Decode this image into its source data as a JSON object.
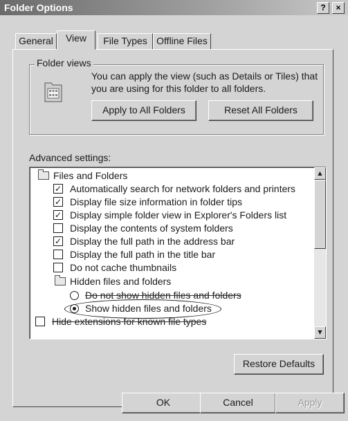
{
  "window": {
    "title": "Folder Options",
    "help_label": "?",
    "close_label": "×"
  },
  "tabs": [
    {
      "label": "General"
    },
    {
      "label": "View",
      "active": true
    },
    {
      "label": "File Types"
    },
    {
      "label": "Offline Files"
    }
  ],
  "folder_views": {
    "title": "Folder views",
    "description_line1": "You can apply the view (such as Details or Tiles) that",
    "description_line2": "you are using for this folder to all folders.",
    "apply_button": "Apply to All Folders",
    "reset_button": "Reset All Folders",
    "icon": "folder-view-icon"
  },
  "advanced": {
    "label": "Advanced settings:",
    "items": [
      {
        "type": "folder",
        "label": "Files and Folders"
      },
      {
        "type": "checkbox",
        "label": "Automatically search for network folders and printers",
        "checked": true
      },
      {
        "type": "checkbox",
        "label": "Display file size information in folder tips",
        "checked": true
      },
      {
        "type": "checkbox",
        "label": "Display simple folder view in Explorer's Folders list",
        "checked": true
      },
      {
        "type": "checkbox",
        "label": "Display the contents of system folders",
        "checked": false
      },
      {
        "type": "checkbox",
        "label": "Display the full path in the address bar",
        "checked": true
      },
      {
        "type": "checkbox",
        "label": "Display the full path in the title bar",
        "checked": false
      },
      {
        "type": "checkbox",
        "label": "Do not cache thumbnails",
        "checked": false
      },
      {
        "type": "folder",
        "label": "Hidden files and folders"
      },
      {
        "type": "radio",
        "label": "Do not show hidden files and folders",
        "selected": false,
        "struck": true
      },
      {
        "type": "radio",
        "label": "Show hidden files and folders",
        "selected": true,
        "circled": true
      },
      {
        "type": "checkbox",
        "label": "Hide extensions for known file types",
        "checked": false,
        "struck": true
      }
    ]
  },
  "restore_defaults": "Restore Defaults",
  "footer": {
    "ok": "OK",
    "cancel": "Cancel",
    "apply": "Apply"
  },
  "icons": {
    "scroll_up": "▲",
    "scroll_down": "▼",
    "check": "✓"
  }
}
